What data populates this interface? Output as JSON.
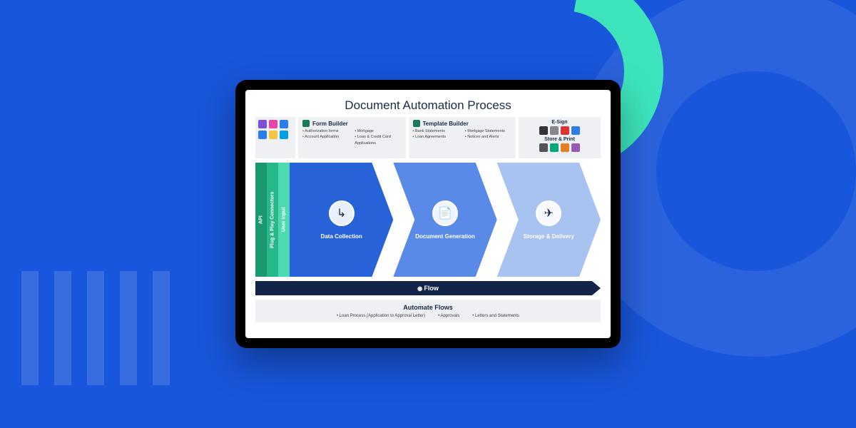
{
  "title": "Document Automation Process",
  "topBoxes": {
    "formBuilder": {
      "title": "Form Builder",
      "col1": [
        "• Authorization forms",
        "• Account Application"
      ],
      "col2": [
        "• Mortgage",
        "• Loan & Credit Card Applications"
      ]
    },
    "templateBuilder": {
      "title": "Template Builder",
      "col1": [
        "• Bank Statements",
        "• Loan Agreements"
      ],
      "col2": [
        "• Mortgage Statements",
        "• Notices and Alerts"
      ]
    },
    "esign": {
      "label1": "E-Sign",
      "label2": "Store & Print"
    }
  },
  "sideLabels": {
    "v1": "API",
    "v2": "Plug & Play Connectors",
    "v3": "User Input"
  },
  "chevrons": {
    "c1": "Data Collection",
    "c2": "Document Generation",
    "c3": "Storage & Delivery"
  },
  "flowLabel": "Flow",
  "automate": {
    "title": "Automate Flows",
    "items": [
      "• Loan Process (Application to Approval Letter)",
      "• Approvals",
      "• Letters and Statements"
    ]
  }
}
